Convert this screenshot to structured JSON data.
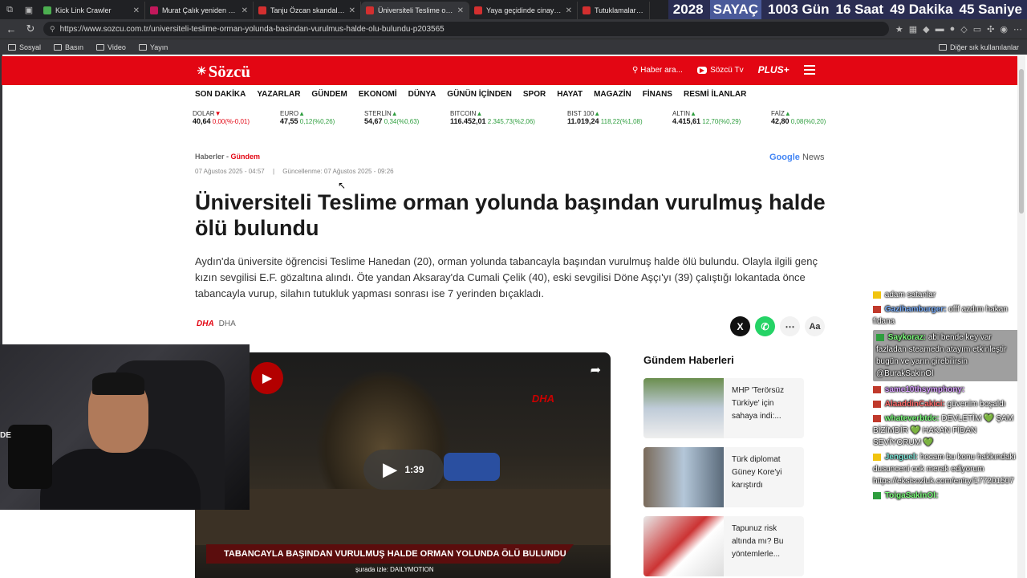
{
  "tabs": [
    {
      "title": "Kick Link Crawler",
      "fav": "k"
    },
    {
      "title": "Murat Çalık yeniden cezae",
      "fav": "b"
    },
    {
      "title": "Tanju Özcan skandalı anlat",
      "fav": "r"
    },
    {
      "title": "Üniversiteli Teslime orman",
      "fav": "r"
    },
    {
      "title": "Yaya geçidinde cinayete te",
      "fav": "r"
    },
    {
      "title": "Tutuklamalar iyi p",
      "fav": "r"
    }
  ],
  "counter": {
    "year": "2028",
    "label": "SAYAÇ",
    "days": "1003 Gün",
    "hours": "16 Saat",
    "minutes": "49 Dakika",
    "seconds": "45 Saniye"
  },
  "url": "https://www.sozcu.com.tr/universiteli-teslime-orman-yolunda-basindan-vurulmus-halde-olu-bulundu-p203565",
  "bookmarks": [
    "Sosyal",
    "Basın",
    "Video",
    "Yayın"
  ],
  "bookmarks_right": "Diğer sık kullanılanlar",
  "site": {
    "logo": "Sözcü",
    "search": "Haber ara...",
    "tv": "Sözcü Tv",
    "plus": "PLUS+"
  },
  "nav": [
    "SON DAKİKA",
    "YAZARLAR",
    "GÜNDEM",
    "EKONOMİ",
    "DÜNYA",
    "GÜNÜN İÇİNDEN",
    "SPOR",
    "HAYAT",
    "MAGAZİN",
    "FİNANS",
    "RESMİ İLANLAR"
  ],
  "markets": [
    {
      "name": "DOLAR",
      "dir": "dn",
      "value": "40,64",
      "change": "0,00(%-0,01)"
    },
    {
      "name": "EURO",
      "dir": "up",
      "value": "47,55",
      "change": "0,12(%0,26)"
    },
    {
      "name": "STERLİN",
      "dir": "up",
      "value": "54,67",
      "change": "0,34(%0,63)"
    },
    {
      "name": "BITCOIN",
      "dir": "up",
      "value": "116.452,01",
      "change": "2.345,73(%2,06)"
    },
    {
      "name": "BIST 100",
      "dir": "up",
      "value": "11.019,24",
      "change": "118,22(%1,08)"
    },
    {
      "name": "ALTIN",
      "dir": "up",
      "value": "4.415,61",
      "change": "12,70(%0,29)"
    },
    {
      "name": "FAİZ",
      "dir": "up",
      "value": "42,80",
      "change": "0,08(%0,20)"
    }
  ],
  "article": {
    "crumb_home": "Haberler",
    "crumb_cat": "Gündem",
    "google_news": "News",
    "date": "07 Ağustos 2025 - 04:57",
    "updated": "Güncellenme: 07 Ağustos 2025 - 09:26",
    "title": "Üniversiteli Teslime orman yolunda başından vurulmuş halde ölü bulundu",
    "summary": "Aydın'da üniversite öğrencisi Teslime Hanedan (20), orman yolunda tabancayla başından vurulmuş halde ölü bulundu. Olayla ilgili genç kızın sevgilisi E.F. gözaltına alındı. Öte yandan Aksaray'da Cumali Çelik (40), eski sevgilisi Döne Aşçı'yı (39) çalıştığı lokantada önce tabancayla vurup, silahın tutukluk yapması sonrası ise 7 yerinden bıçakladı.",
    "source": "DHA"
  },
  "video": {
    "duration": "1:39",
    "banner": "TABANCAYLA BAŞINDAN VURULMUŞ HALDE ORMAN YOLUNDA ÖLÜ BULUNDU",
    "watermark": "DHA",
    "watch_on": "şurada izle: DAILYMOTION"
  },
  "gundem": {
    "title": "Gündem Haberleri",
    "items": [
      "MHP 'Terörsüz Türkiye' için sahaya indi:...",
      "Türk diplomat Güney Kore'yi karıştırdı",
      "Tapunuz risk altında mı? Bu yöntemlerle..."
    ]
  },
  "chat": [
    {
      "user": "",
      "text": "adam satanlar",
      "icon": "y",
      "color": "u-pink"
    },
    {
      "user": "Gazihamburger:",
      "text": "offf azdım hakan fidana",
      "icon": "r",
      "color": "u-blue"
    },
    {
      "user": "Saykoraz:",
      "text": "abi bende key var fazladan steamedn atayım etkinleştir bugün ve yarın girebilirsin @BurakSakinOl",
      "icon": "g",
      "color": "u-green",
      "hl": true
    },
    {
      "user": "same10thsymphony:",
      "text": "",
      "icon": "r",
      "color": "u-purple"
    },
    {
      "user": "AlaaddinCakici:",
      "text": "güvenim boşaldı",
      "icon": "r",
      "color": "u-red"
    },
    {
      "user": "whateverbtdc:",
      "text": "DEVLETİM 💚 ŞAM BİZİMDİR 💚 HAKAN FİDAN SEVİYORUM 💚",
      "icon": "r",
      "color": "u-green"
    },
    {
      "user": "Jenguel:",
      "text": "hocam bu konu hakkındaki dusunceni cok merak ediyorum https://eksisozluk.com/entry/177201507",
      "icon": "y",
      "color": "u-teal"
    },
    {
      "user": "ToigaSakinOl:",
      "text": "",
      "icon": "g",
      "color": "u-green"
    }
  ],
  "webcam_text": "DE"
}
